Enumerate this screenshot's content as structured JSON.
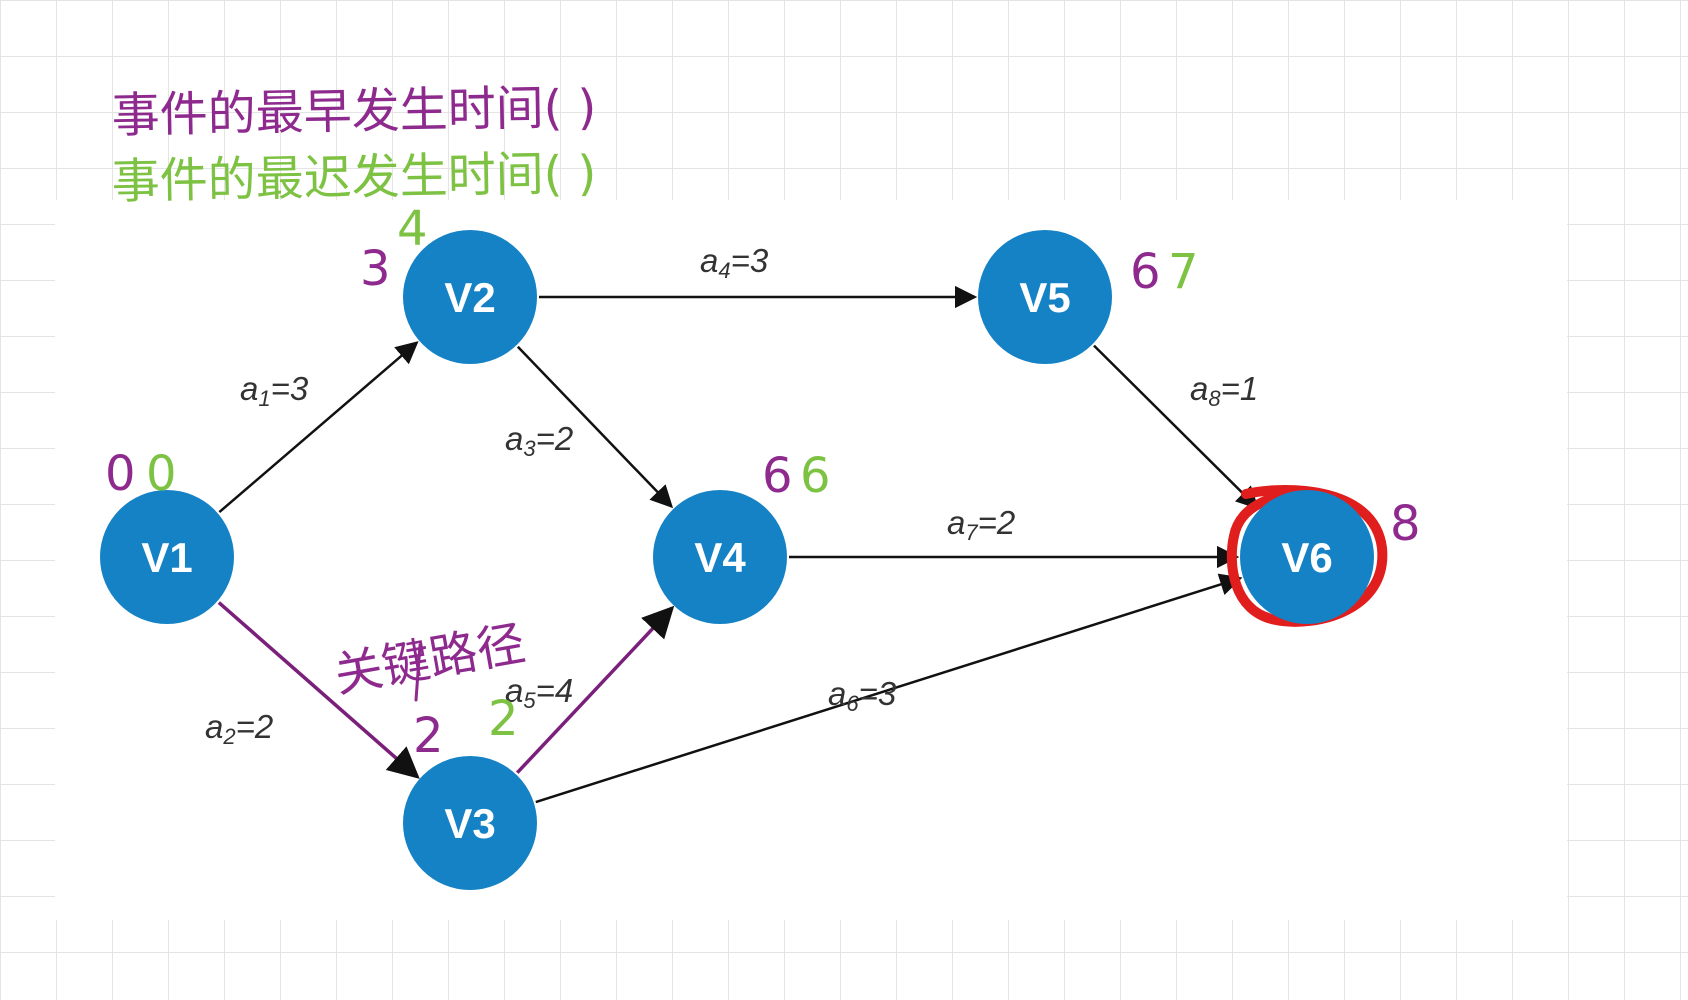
{
  "annotations": {
    "earliest_title": "事件的最早发生时间( )",
    "latest_title": "事件的最迟发生时间( )",
    "critical_path": "关键路径",
    "earliest_color": "#8e2a8e",
    "latest_color": "#7dc242",
    "highlight_color": "#e01e1e"
  },
  "colors": {
    "node_fill": "#1582c5",
    "edge_default": "#111111",
    "edge_critical": "#7a1f7a"
  },
  "nodes": [
    {
      "id": "V1",
      "label": "V1",
      "earliest": "0",
      "latest": "0"
    },
    {
      "id": "V2",
      "label": "V2",
      "earliest": "3",
      "latest": "4"
    },
    {
      "id": "V3",
      "label": "V3",
      "earliest": "2",
      "latest": "2"
    },
    {
      "id": "V4",
      "label": "V4",
      "earliest": "6",
      "latest": "6"
    },
    {
      "id": "V5",
      "label": "V5",
      "earliest": "6",
      "latest": "7"
    },
    {
      "id": "V6",
      "label": "V6",
      "earliest": "8",
      "latest": ""
    }
  ],
  "edges": [
    {
      "from": "V1",
      "to": "V2",
      "name": "a",
      "sub": "1",
      "weight": "=3",
      "critical": false
    },
    {
      "from": "V1",
      "to": "V3",
      "name": "a",
      "sub": "2",
      "weight": "=2",
      "critical": true
    },
    {
      "from": "V2",
      "to": "V4",
      "name": "a",
      "sub": "3",
      "weight": "=2",
      "critical": false
    },
    {
      "from": "V2",
      "to": "V5",
      "name": "a",
      "sub": "4",
      "weight": "=3",
      "critical": false
    },
    {
      "from": "V3",
      "to": "V4",
      "name": "a",
      "sub": "5",
      "weight": "=4",
      "critical": true
    },
    {
      "from": "V3",
      "to": "V6",
      "name": "a",
      "sub": "6",
      "weight": "=3",
      "critical": false
    },
    {
      "from": "V4",
      "to": "V6",
      "name": "a",
      "sub": "7",
      "weight": "=2",
      "critical": false
    },
    {
      "from": "V5",
      "to": "V6",
      "name": "a",
      "sub": "8",
      "weight": "=1",
      "critical": false
    }
  ]
}
